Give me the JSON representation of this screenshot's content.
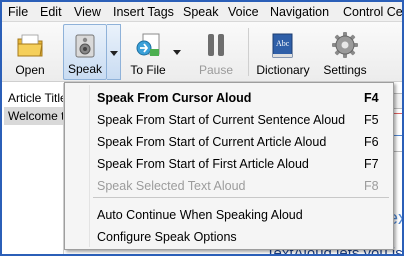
{
  "menubar": {
    "items": [
      "File",
      "Edit",
      "View",
      "Insert Tags",
      "Speak",
      "Voice",
      "Navigation",
      "Control Cen"
    ]
  },
  "toolbar": {
    "open": {
      "label": "Open",
      "icon": "folder-icon"
    },
    "speak": {
      "label": "Speak",
      "icon": "speaker-icon"
    },
    "to_file": {
      "label": "To File",
      "icon": "save-to-file-icon"
    },
    "pause": {
      "label": "Pause",
      "icon": "pause-icon",
      "disabled": true
    },
    "dictionary": {
      "label": "Dictionary",
      "icon": "dictionary-book-icon"
    },
    "settings": {
      "label": "Settings",
      "icon": "gear-icon"
    }
  },
  "document": {
    "article_header": "Article Title",
    "welcome_row": "Welcome to",
    "bottom_text": "TextAloud lets you is"
  },
  "speak_menu": {
    "items": [
      {
        "label": "Speak From Cursor Aloud",
        "shortcut": "F4",
        "bold": true,
        "disabled": false
      },
      {
        "label": "Speak From Start of Current Sentence Aloud",
        "shortcut": "F5",
        "bold": false,
        "disabled": false
      },
      {
        "label": "Speak From Start of Current Article Aloud",
        "shortcut": "F6",
        "bold": false,
        "disabled": false
      },
      {
        "label": "Speak From Start of First Article Aloud",
        "shortcut": "F7",
        "bold": false,
        "disabled": false
      },
      {
        "label": "Speak Selected Text Aloud",
        "shortcut": "F8",
        "bold": false,
        "disabled": true
      },
      {
        "label": "Auto Continue When Speaking Aloud",
        "shortcut": "",
        "bold": false,
        "disabled": false
      },
      {
        "label": "Configure Speak Options",
        "shortcut": "",
        "bold": false,
        "disabled": false
      }
    ]
  },
  "colors": {
    "window_border": "#2b5fb8",
    "menu_bg": "#f5f5f5",
    "disabled_text": "#9c9c9c",
    "pressed_button": "#c9dcf2"
  }
}
